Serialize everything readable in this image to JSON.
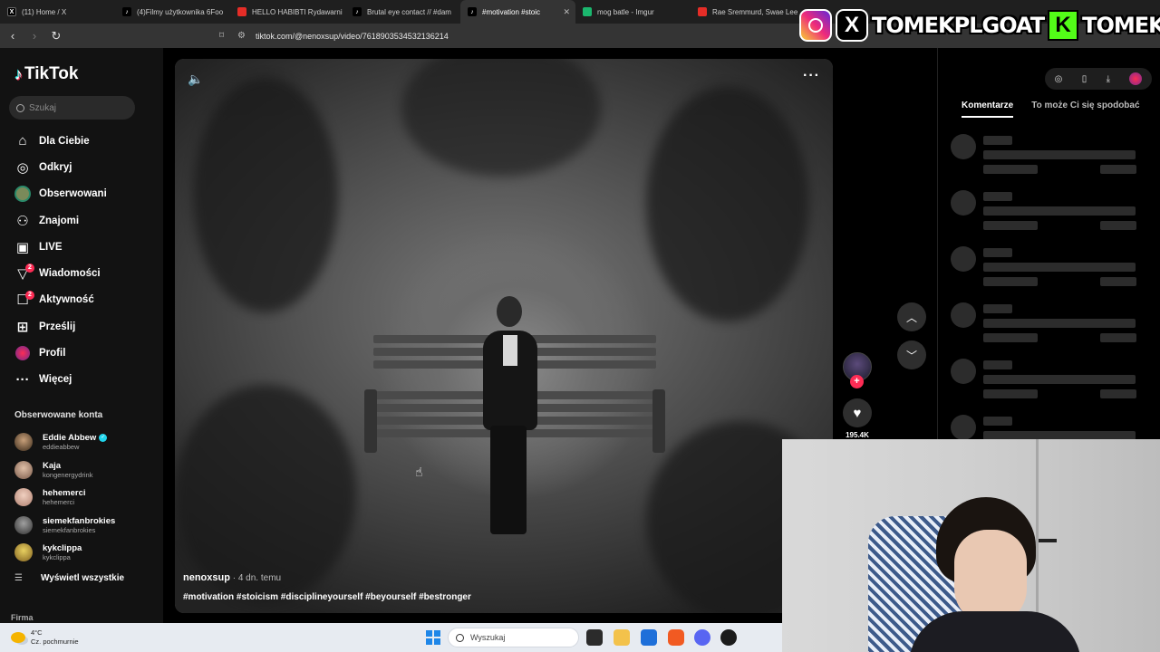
{
  "browser": {
    "tabs": [
      {
        "label": "(11) Home / X",
        "icon": "x-icon"
      },
      {
        "label": "(4)Filmy użytkownika 6Foo",
        "icon": "tiktok-icon"
      },
      {
        "label": "HELLO HABIBTI Rydawarni",
        "icon": "youtube-icon"
      },
      {
        "label": "Brutal eye contact // #dam",
        "icon": "tiktok-icon"
      },
      {
        "label": "#motivation #stoic",
        "icon": "tiktok-icon",
        "active": true
      },
      {
        "label": "mog batle - Imgur",
        "icon": "imgur-icon"
      },
      {
        "label": "Rae Sremmurd, Swae Lee",
        "icon": "youtube-icon"
      }
    ],
    "url": "tiktok.com/@nenoxsup/video/7618903534532136214"
  },
  "overlay": {
    "handle_x": "TOMEKPLGOAT",
    "handle_kick": "TOMEKPL",
    "kick_letter": "K"
  },
  "sidebar": {
    "logo": "TikTok",
    "search_placeholder": "Szukaj",
    "nav": [
      {
        "label": "Dla Ciebie",
        "icon": "home-icon"
      },
      {
        "label": "Odkryj",
        "icon": "compass-icon"
      },
      {
        "label": "Obserwowani",
        "icon": "following-avatar-icon"
      },
      {
        "label": "Znajomi",
        "icon": "friends-icon"
      },
      {
        "label": "LIVE",
        "icon": "live-icon"
      },
      {
        "label": "Wiadomości",
        "icon": "messages-icon",
        "badge": "2"
      },
      {
        "label": "Aktywność",
        "icon": "activity-icon",
        "badge": "2"
      },
      {
        "label": "Prześlij",
        "icon": "upload-icon"
      },
      {
        "label": "Profil",
        "icon": "profile-icon"
      },
      {
        "label": "Więcej",
        "icon": "more-icon"
      }
    ],
    "following_title": "Obserwowane konta",
    "accounts": [
      {
        "name": "Eddie Abbew",
        "handle": "eddieabbew",
        "verified": true
      },
      {
        "name": "Kaja",
        "handle": "kongenergydrink"
      },
      {
        "name": "hehemerci",
        "handle": "hehemerci"
      },
      {
        "name": "siemekfanbrokies",
        "handle": "siemekfanbrokies"
      },
      {
        "name": "kykclippa",
        "handle": "kykclippa"
      }
    ],
    "show_all": "Wyświetl wszystkie",
    "footer": "Firma"
  },
  "video": {
    "author": "nenoxsup",
    "posted": " · 4 dn. temu",
    "hashtags": "#motivation #stoicism #disciplineyourself #beyourself #bestronger",
    "likes": "195.4K"
  },
  "comments": {
    "tabs": [
      "Komentarze",
      "To może Ci się spodobać"
    ]
  },
  "taskbar": {
    "temp": "4°C",
    "weather": "Cz. pochmurnie",
    "search_placeholder": "Wyszukaj"
  }
}
